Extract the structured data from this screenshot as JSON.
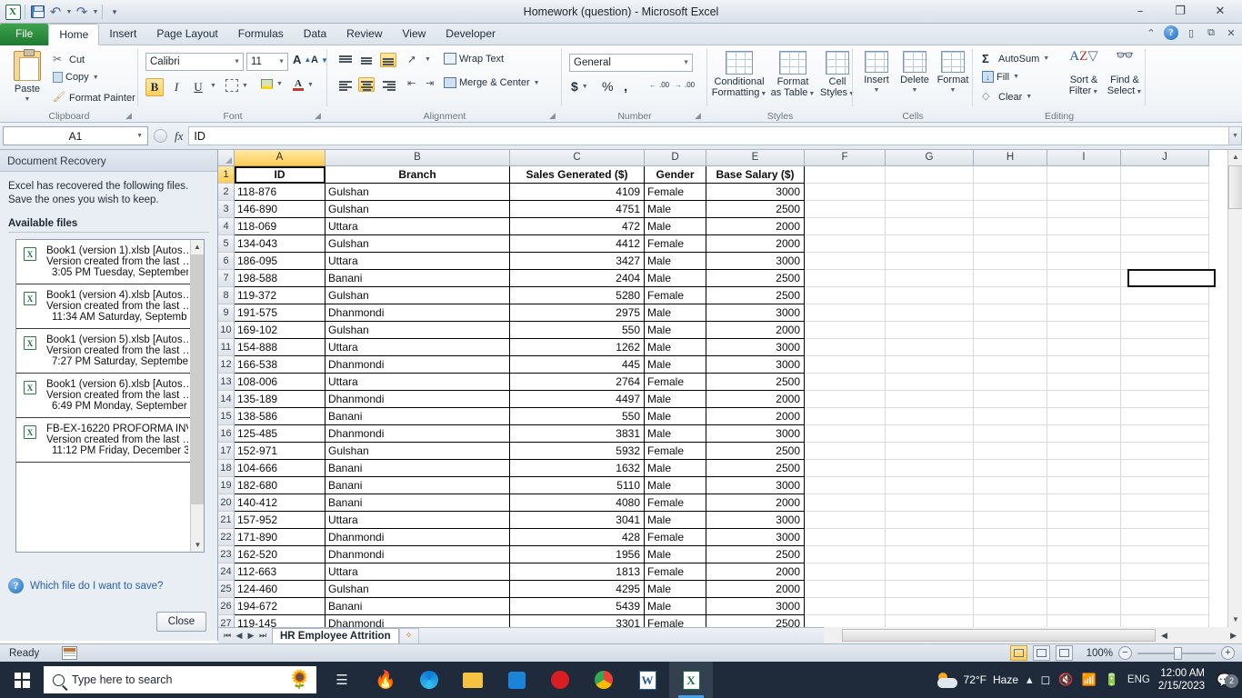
{
  "window": {
    "title": "Homework (question)  -  Microsoft Excel",
    "minimize": "–",
    "restore": "❐",
    "close": "✕",
    "collapse_ribbon": "⌃",
    "help": "?"
  },
  "qat": {
    "app_icon": "X",
    "save": "save-icon",
    "undo": "↶",
    "redo": "↷",
    "customize": "☰"
  },
  "tabs": [
    {
      "label": "File",
      "type": "file"
    },
    {
      "label": "Home",
      "type": "active"
    },
    {
      "label": "Insert",
      "type": "normal"
    },
    {
      "label": "Page Layout",
      "type": "normal"
    },
    {
      "label": "Formulas",
      "type": "normal"
    },
    {
      "label": "Data",
      "type": "normal"
    },
    {
      "label": "Review",
      "type": "normal"
    },
    {
      "label": "View",
      "type": "normal"
    },
    {
      "label": "Developer",
      "type": "normal"
    }
  ],
  "ribbon": {
    "clipboard": {
      "group_label": "Clipboard",
      "paste": "Paste",
      "cut": "Cut",
      "copy": "Copy",
      "format_painter": "Format Painter"
    },
    "font": {
      "group_label": "Font",
      "font_name": "Calibri",
      "font_size": "11",
      "grow_font": "A",
      "shrink_font": "A",
      "bold": "B",
      "italic": "I",
      "underline": "U"
    },
    "alignment": {
      "group_label": "Alignment",
      "wrap_text": "Wrap Text",
      "merge_center": "Merge & Center"
    },
    "number": {
      "group_label": "Number",
      "format": "General",
      "currency": "$",
      "percent": "%",
      "comma": ",",
      "increase_decimal": ".00",
      "decrease_decimal": ".00"
    },
    "styles": {
      "group_label": "Styles",
      "conditional_formatting": "Conditional\nFormatting",
      "cf_l1": "Conditional",
      "cf_l2": "Formatting",
      "fat_l1": "Format",
      "fat_l2": "as Table",
      "cs_l1": "Cell",
      "cs_l2": "Styles"
    },
    "cells": {
      "group_label": "Cells",
      "insert": "Insert",
      "delete": "Delete",
      "format": "Format"
    },
    "editing": {
      "group_label": "Editing",
      "autosum": "AutoSum",
      "fill": "Fill",
      "clear": "Clear",
      "sf_l1": "Sort &",
      "sf_l2": "Filter",
      "fs_l1": "Find &",
      "fs_l2": "Select"
    }
  },
  "formula_bar": {
    "name_box": "A1",
    "fx_label": "fx",
    "value": "ID"
  },
  "recovery": {
    "title": "Document Recovery",
    "description": "Excel has recovered the following files.  Save the ones you wish to keep.",
    "available_label": "Available files",
    "files": [
      {
        "name": "Book1 (version 1).xlsb  [Autos…",
        "detail": "Version created from the last …",
        "time": "3:05 PM Tuesday, September …"
      },
      {
        "name": "Book1 (version 4).xlsb  [Autos…",
        "detail": "Version created from the last …",
        "time": "11:34 AM Saturday, Septemb…"
      },
      {
        "name": "Book1 (version 5).xlsb  [Autos…",
        "detail": "Version created from the last …",
        "time": "7:27 PM Saturday, September…"
      },
      {
        "name": "Book1 (version 6).xlsb  [Autos…",
        "detail": "Version created from the last …",
        "time": "6:49 PM Monday, September …"
      },
      {
        "name": "FB-EX-16220 PROFORMA INV…",
        "detail": "Version created from the last …",
        "time": "11:12 PM Friday, December 3…"
      }
    ],
    "help_link": "Which file do I want to save?",
    "close_button": "Close"
  },
  "sheet": {
    "column_headers": [
      "A",
      "B",
      "C",
      "D",
      "E",
      "F",
      "G",
      "H",
      "I",
      "J"
    ],
    "selected_column": "A",
    "selected_row": "1",
    "active_cell": "A1",
    "table_headers": [
      "ID",
      "Branch",
      "Sales Generated ($)",
      "Gender",
      "Base Salary ($)"
    ],
    "rows": [
      {
        "n": "2",
        "id": "118-876",
        "branch": "Gulshan",
        "sales": "4109",
        "gender": "Female",
        "salary": "3000"
      },
      {
        "n": "3",
        "id": "146-890",
        "branch": "Gulshan",
        "sales": "4751",
        "gender": "Male",
        "salary": "2500"
      },
      {
        "n": "4",
        "id": "118-069",
        "branch": "Uttara",
        "sales": "472",
        "gender": "Male",
        "salary": "2000"
      },
      {
        "n": "5",
        "id": "134-043",
        "branch": "Gulshan",
        "sales": "4412",
        "gender": "Female",
        "salary": "2000"
      },
      {
        "n": "6",
        "id": "186-095",
        "branch": "Uttara",
        "sales": "3427",
        "gender": "Male",
        "salary": "3000"
      },
      {
        "n": "7",
        "id": "198-588",
        "branch": "Banani",
        "sales": "2404",
        "gender": "Male",
        "salary": "2500"
      },
      {
        "n": "8",
        "id": "119-372",
        "branch": "Gulshan",
        "sales": "5280",
        "gender": "Female",
        "salary": "2500"
      },
      {
        "n": "9",
        "id": "191-575",
        "branch": "Dhanmondi",
        "sales": "2975",
        "gender": "Male",
        "salary": "3000"
      },
      {
        "n": "10",
        "id": "169-102",
        "branch": "Gulshan",
        "sales": "550",
        "gender": "Male",
        "salary": "2000"
      },
      {
        "n": "11",
        "id": "154-888",
        "branch": "Uttara",
        "sales": "1262",
        "gender": "Male",
        "salary": "3000"
      },
      {
        "n": "12",
        "id": "166-538",
        "branch": "Dhanmondi",
        "sales": "445",
        "gender": "Male",
        "salary": "3000"
      },
      {
        "n": "13",
        "id": "108-006",
        "branch": "Uttara",
        "sales": "2764",
        "gender": "Female",
        "salary": "2500"
      },
      {
        "n": "14",
        "id": "135-189",
        "branch": "Dhanmondi",
        "sales": "4497",
        "gender": "Male",
        "salary": "2000"
      },
      {
        "n": "15",
        "id": "138-586",
        "branch": "Banani",
        "sales": "550",
        "gender": "Male",
        "salary": "2000"
      },
      {
        "n": "16",
        "id": "125-485",
        "branch": "Dhanmondi",
        "sales": "3831",
        "gender": "Male",
        "salary": "3000"
      },
      {
        "n": "17",
        "id": "152-971",
        "branch": "Gulshan",
        "sales": "5932",
        "gender": "Female",
        "salary": "2500"
      },
      {
        "n": "18",
        "id": "104-666",
        "branch": "Banani",
        "sales": "1632",
        "gender": "Male",
        "salary": "2500"
      },
      {
        "n": "19",
        "id": "182-680",
        "branch": "Banani",
        "sales": "5110",
        "gender": "Male",
        "salary": "3000"
      },
      {
        "n": "20",
        "id": "140-412",
        "branch": "Banani",
        "sales": "4080",
        "gender": "Female",
        "salary": "2000"
      },
      {
        "n": "21",
        "id": "157-952",
        "branch": "Uttara",
        "sales": "3041",
        "gender": "Male",
        "salary": "3000"
      },
      {
        "n": "22",
        "id": "171-890",
        "branch": "Dhanmondi",
        "sales": "428",
        "gender": "Female",
        "salary": "3000"
      },
      {
        "n": "23",
        "id": "162-520",
        "branch": "Dhanmondi",
        "sales": "1956",
        "gender": "Male",
        "salary": "2500"
      },
      {
        "n": "24",
        "id": "112-663",
        "branch": "Uttara",
        "sales": "1813",
        "gender": "Female",
        "salary": "2000"
      },
      {
        "n": "25",
        "id": "124-460",
        "branch": "Gulshan",
        "sales": "4295",
        "gender": "Male",
        "salary": "2000"
      },
      {
        "n": "26",
        "id": "194-672",
        "branch": "Banani",
        "sales": "5439",
        "gender": "Male",
        "salary": "3000"
      },
      {
        "n": "27",
        "id": "119-145",
        "branch": "Dhanmondi",
        "sales": "3301",
        "gender": "Female",
        "salary": "2500"
      }
    ],
    "sheet_tab": "HR Employee Attrition",
    "new_sheet": "➕"
  },
  "status_bar": {
    "state": "Ready",
    "zoom": "100%",
    "zoom_out": "−",
    "zoom_in": "+"
  },
  "taskbar": {
    "search_placeholder": "Type here to search",
    "apps": [
      "task-view",
      "firefox",
      "edge",
      "file-explorer",
      "microsoft-store",
      "opera",
      "chrome",
      "word",
      "excel"
    ],
    "weather_temp": "72°F",
    "weather_desc": "Haze",
    "language": "ENG",
    "time": "12:00 AM",
    "date": "2/15/2023",
    "notification_count": "2"
  },
  "colors": {
    "excel_green": "#1d7044",
    "selection_gold": "#ffcd55",
    "accent_blue": "#48a0e8"
  }
}
